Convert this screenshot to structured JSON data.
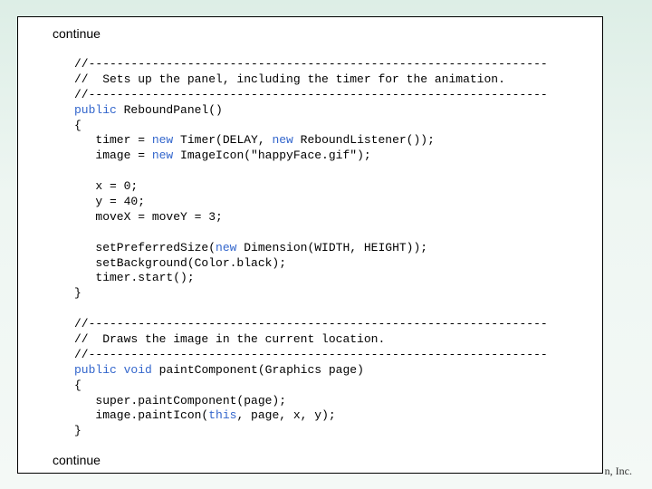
{
  "slide": {
    "continue_top": "continue",
    "continue_bottom": "continue",
    "footer_text": "n, Inc."
  },
  "colors": {
    "keyword": "#3366cc",
    "text": "#000000",
    "background": "#ddeee6"
  },
  "code": [
    [
      {
        "t": "//-----------------------------------------------------------------",
        "k": 0
      }
    ],
    [
      {
        "t": "//  Sets up the panel, including the timer for the animation.",
        "k": 0
      }
    ],
    [
      {
        "t": "//-----------------------------------------------------------------",
        "k": 0
      }
    ],
    [
      {
        "t": "public",
        "k": 1
      },
      {
        "t": " ReboundPanel()",
        "k": 0
      }
    ],
    [
      {
        "t": "{",
        "k": 0
      }
    ],
    [
      {
        "t": "   timer = ",
        "k": 0
      },
      {
        "t": "new",
        "k": 1
      },
      {
        "t": " Timer(DELAY, ",
        "k": 0
      },
      {
        "t": "new",
        "k": 1
      },
      {
        "t": " ReboundListener());",
        "k": 0
      }
    ],
    [
      {
        "t": "   image = ",
        "k": 0
      },
      {
        "t": "new",
        "k": 1
      },
      {
        "t": " ImageIcon(\"happyFace.gif\");",
        "k": 0
      }
    ],
    [
      {
        "t": "",
        "k": 0
      }
    ],
    [
      {
        "t": "   x = 0;",
        "k": 0
      }
    ],
    [
      {
        "t": "   y = 40;",
        "k": 0
      }
    ],
    [
      {
        "t": "   moveX = moveY = 3;",
        "k": 0
      }
    ],
    [
      {
        "t": "",
        "k": 0
      }
    ],
    [
      {
        "t": "   setPreferredSize(",
        "k": 0
      },
      {
        "t": "new",
        "k": 1
      },
      {
        "t": " Dimension(WIDTH, HEIGHT));",
        "k": 0
      }
    ],
    [
      {
        "t": "   setBackground(Color.black);",
        "k": 0
      }
    ],
    [
      {
        "t": "   timer.start();",
        "k": 0
      }
    ],
    [
      {
        "t": "}",
        "k": 0
      }
    ],
    [
      {
        "t": "",
        "k": 0
      }
    ],
    [
      {
        "t": "//-----------------------------------------------------------------",
        "k": 0
      }
    ],
    [
      {
        "t": "//  Draws the image in the current location.",
        "k": 0
      }
    ],
    [
      {
        "t": "//-----------------------------------------------------------------",
        "k": 0
      }
    ],
    [
      {
        "t": "public",
        "k": 1
      },
      {
        "t": " ",
        "k": 0
      },
      {
        "t": "void",
        "k": 1
      },
      {
        "t": " paintComponent(Graphics page)",
        "k": 0
      }
    ],
    [
      {
        "t": "{",
        "k": 0
      }
    ],
    [
      {
        "t": "   super.paintComponent(page);",
        "k": 0
      }
    ],
    [
      {
        "t": "   image.paintIcon(",
        "k": 0
      },
      {
        "t": "this",
        "k": 1
      },
      {
        "t": ", page, x, y);",
        "k": 0
      }
    ],
    [
      {
        "t": "}",
        "k": 0
      }
    ]
  ]
}
